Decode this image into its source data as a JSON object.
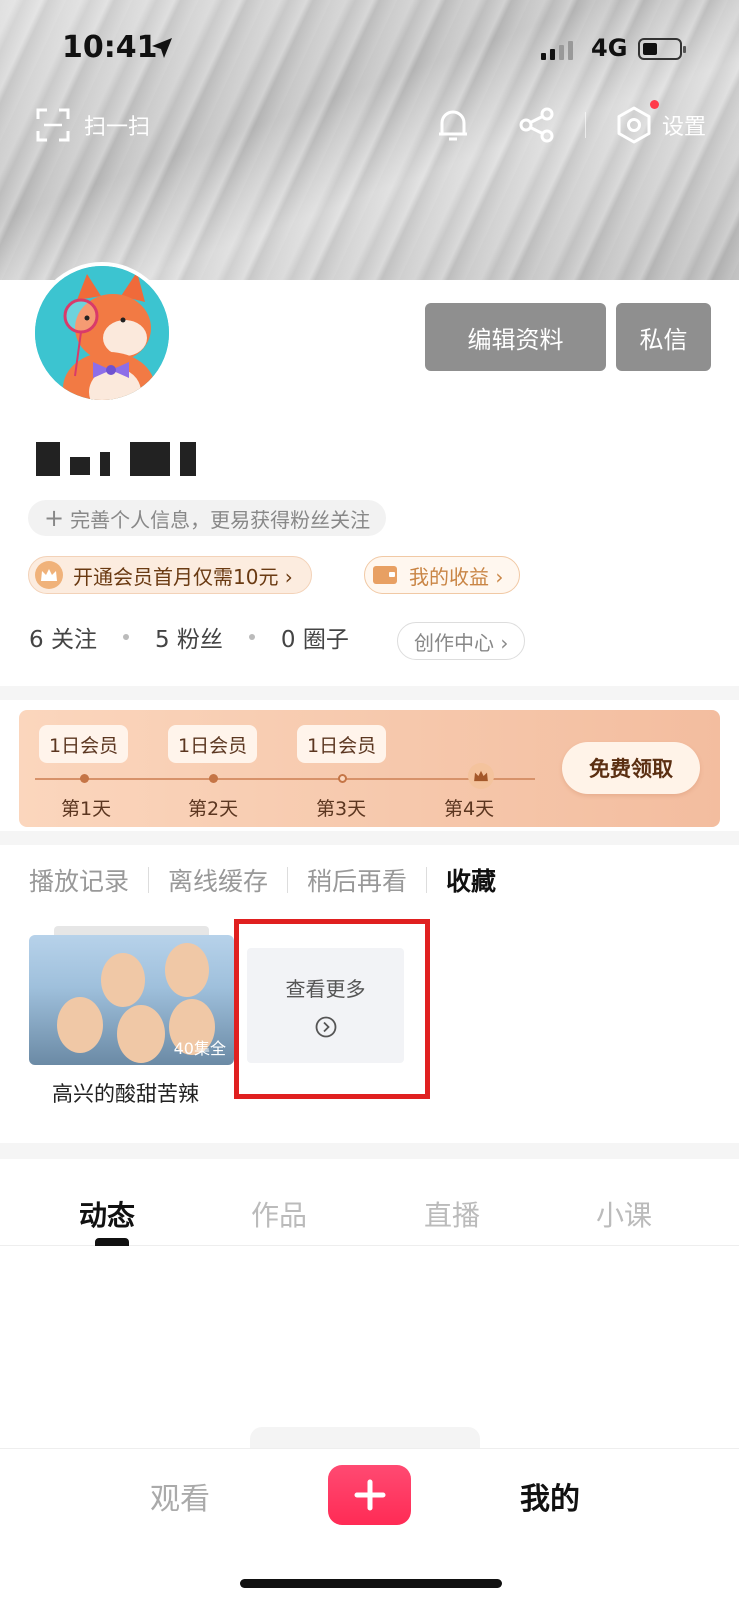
{
  "status_bar": {
    "time": "10:41",
    "network": "4G"
  },
  "top_bar": {
    "scan_label": "扫一扫",
    "settings_label": "设置"
  },
  "profile": {
    "edit_button": "编辑资料",
    "message_button": "私信",
    "perfect_info": "完善个人信息，更易获得粉丝关注",
    "vip_text": "开通会员首月仅需10元 ›",
    "earnings_text": "我的收益 ›",
    "following": "6 关注",
    "fans": "5 粉丝",
    "circles": "0 圈子",
    "creator_center": "创作中心 ›"
  },
  "checkin_banner": {
    "rewards": [
      "1日会员",
      "1日会员",
      "1日会员"
    ],
    "days": [
      "第1天",
      "第2天",
      "第3天",
      "第4天"
    ],
    "claim_button": "免费领取"
  },
  "history_tabs": [
    "播放记录",
    "离线缓存",
    "稍后再看",
    "收藏"
  ],
  "collection": {
    "item_title": "高兴的酸甜苦辣",
    "item_episodes": "40集全",
    "see_more": "查看更多"
  },
  "feed_tabs": [
    "动态",
    "作品",
    "直播",
    "小课"
  ],
  "bottom_nav": {
    "watch": "观看",
    "mine": "我的"
  },
  "colors": {
    "accent": "#ff2b55",
    "highlight_box": "#e02020",
    "vip_brown": "#6a3a12"
  }
}
